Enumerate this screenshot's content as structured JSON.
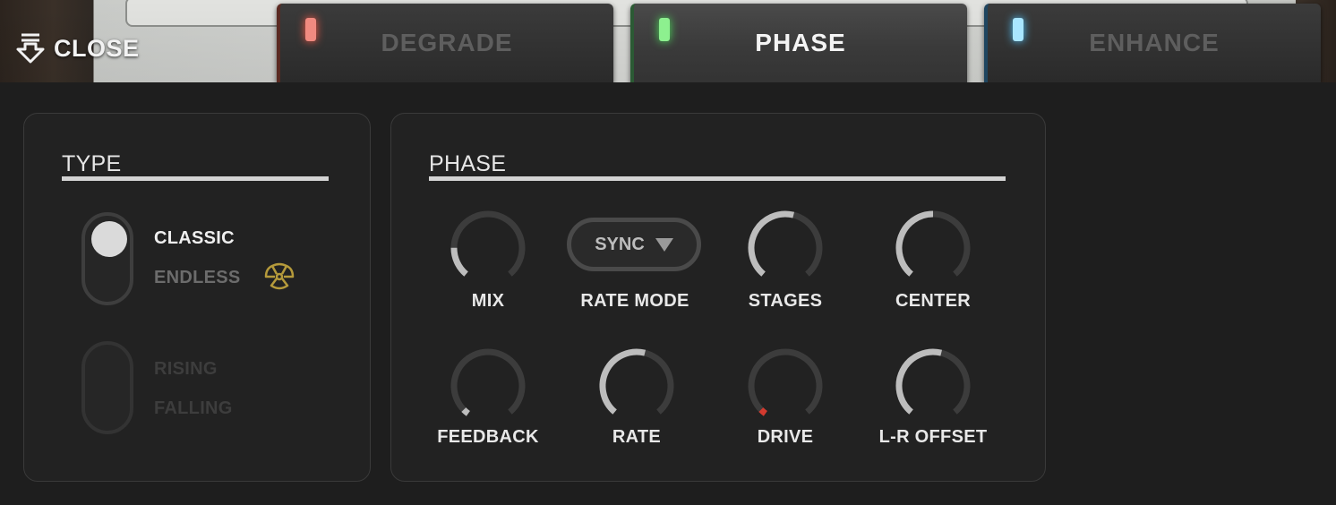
{
  "header": {
    "close_label": "CLOSE",
    "tabs": [
      {
        "label": "DEGRADE",
        "led_color": "#f08a80",
        "active": false
      },
      {
        "label": "PHASE",
        "led_color": "#8df08f",
        "active": true
      },
      {
        "label": "ENHANCE",
        "led_color": "#a9e6ff",
        "active": false
      }
    ]
  },
  "type_panel": {
    "title": "TYPE",
    "switch1": {
      "options": [
        "CLASSIC",
        "ENDLESS"
      ],
      "selected": "CLASSIC",
      "endless_icon": "radiation-icon"
    },
    "switch2": {
      "options": [
        "RISING",
        "FALLING"
      ],
      "enabled": false
    }
  },
  "phase_panel": {
    "title": "PHASE",
    "rate_mode": {
      "label": "RATE MODE",
      "value": "SYNC"
    },
    "knobs": [
      {
        "label": "MIX",
        "value": 0.18
      },
      {
        "label": "STAGES",
        "value": 0.55
      },
      {
        "label": "CENTER",
        "value": 0.5
      },
      {
        "label": "FEEDBACK",
        "value": 0.02
      },
      {
        "label": "RATE",
        "value": 0.55
      },
      {
        "label": "DRIVE",
        "value": 0.02,
        "accent": "#d33a2f"
      },
      {
        "label": "L-R OFFSET",
        "value": 0.55
      }
    ]
  },
  "colors": {
    "knob_track": "#3c3c3c",
    "knob_fill": "#bdbdbd",
    "text_bright": "#efefef",
    "text_dim": "#6c6c6c"
  }
}
